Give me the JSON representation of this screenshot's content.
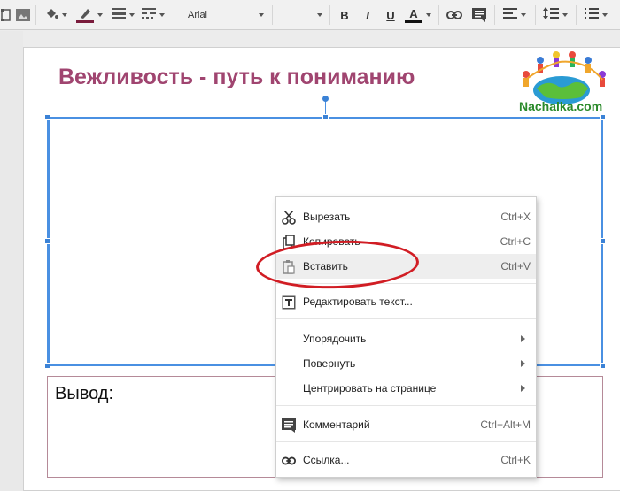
{
  "toolbar": {
    "font_name": "Arial",
    "bold_label": "B",
    "italic_label": "I",
    "underline_label": "U",
    "text_color_label": "A",
    "icons": [
      "text-box-icon",
      "image-icon",
      "fill-color-icon",
      "line-color-icon",
      "line-weight-icon",
      "line-dash-icon",
      "bold-icon",
      "italic-icon",
      "underline-icon",
      "text-color-icon",
      "link-icon",
      "comment-icon",
      "align-icon",
      "line-spacing-icon",
      "numbered-list-icon"
    ],
    "colors": {
      "line_color": "#7a1c3c",
      "text_color": "#111111"
    }
  },
  "slide": {
    "title": "Вежливость - путь к пониманию",
    "logo_text": "Nachalka.com",
    "conclusion_label": "Вывод:",
    "title_color": "#a04570",
    "selection_color": "#4a90e2"
  },
  "context_menu": {
    "items": [
      {
        "label": "Вырезать",
        "shortcut": "Ctrl+X",
        "icon": "scissors-icon"
      },
      {
        "label": "Копировать",
        "shortcut": "Ctrl+C",
        "icon": "copy-icon"
      },
      {
        "label": "Вставить",
        "shortcut": "Ctrl+V",
        "icon": "paste-icon",
        "highlighted": true
      },
      {
        "label": "Редактировать текст...",
        "shortcut": "",
        "icon": "text-edit-icon"
      },
      {
        "label": "Упорядочить",
        "shortcut": "",
        "submenu": true
      },
      {
        "label": "Повернуть",
        "shortcut": "",
        "submenu": true
      },
      {
        "label": "Центрировать на странице",
        "shortcut": "",
        "submenu": true
      },
      {
        "label": "Комментарий",
        "shortcut": "Ctrl+Alt+M",
        "icon": "comment-icon"
      },
      {
        "label": "Ссылка...",
        "shortcut": "Ctrl+K",
        "icon": "link-icon"
      }
    ]
  },
  "annotation": {
    "color": "#d11d24"
  }
}
